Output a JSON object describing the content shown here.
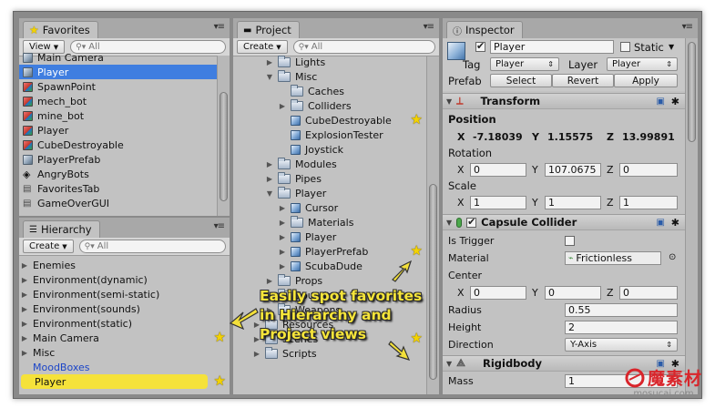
{
  "favorites": {
    "tab_label": "Favorites",
    "view_label": "View",
    "search_placeholder": "All",
    "items": [
      {
        "label": "Main Camera",
        "icon": "cube-gray"
      },
      {
        "label": "Player",
        "icon": "cube-gray",
        "selected": true
      },
      {
        "label": "SpawnPoint",
        "icon": "cube-red"
      },
      {
        "label": "mech_bot",
        "icon": "cube-red"
      },
      {
        "label": "mine_bot",
        "icon": "cube-red"
      },
      {
        "label": "Player",
        "icon": "cube-red"
      },
      {
        "label": "CubeDestroyable",
        "icon": "cube-red"
      },
      {
        "label": "PlayerPrefab",
        "icon": "cube-gray"
      },
      {
        "label": "AngryBots",
        "icon": "unity-icon"
      },
      {
        "label": "FavoritesTab",
        "icon": "script-icon"
      },
      {
        "label": "GameOverGUI",
        "icon": "script-icon"
      }
    ]
  },
  "hierarchy": {
    "tab_label": "Hierarchy",
    "create_label": "Create",
    "search_placeholder": "All",
    "items": [
      {
        "label": "Enemies",
        "arrow": true
      },
      {
        "label": "Environment(dynamic)",
        "arrow": true
      },
      {
        "label": "Environment(semi-static)",
        "arrow": true
      },
      {
        "label": "Environment(sounds)",
        "arrow": true
      },
      {
        "label": "Environment(static)",
        "arrow": true
      },
      {
        "label": "Main Camera",
        "arrow": true,
        "star": true
      },
      {
        "label": "Misc",
        "arrow": true
      },
      {
        "label": "MoodBoxes",
        "arrow": false,
        "blue": true
      },
      {
        "label": "Player",
        "arrow": false,
        "highlight": true,
        "star": true
      }
    ]
  },
  "project": {
    "tab_label": "Project",
    "create_label": "Create",
    "search_placeholder": "All",
    "items": [
      {
        "label": "Lights",
        "depth": 0,
        "arrow": "right",
        "icon": "folder"
      },
      {
        "label": "Misc",
        "depth": 0,
        "arrow": "down",
        "icon": "folder"
      },
      {
        "label": "Caches",
        "depth": 1,
        "arrow": "",
        "icon": "folder"
      },
      {
        "label": "Colliders",
        "depth": 1,
        "arrow": "right",
        "icon": "folder"
      },
      {
        "label": "CubeDestroyable",
        "depth": 1,
        "arrow": "",
        "icon": "cube",
        "star": true
      },
      {
        "label": "ExplosionTester",
        "depth": 1,
        "arrow": "",
        "icon": "cube"
      },
      {
        "label": "Joystick",
        "depth": 1,
        "arrow": "",
        "icon": "cube"
      },
      {
        "label": "Modules",
        "depth": 0,
        "arrow": "right",
        "icon": "folder"
      },
      {
        "label": "Pipes",
        "depth": 0,
        "arrow": "right",
        "icon": "folder"
      },
      {
        "label": "Player",
        "depth": 0,
        "arrow": "down",
        "icon": "folder"
      },
      {
        "label": "Cursor",
        "depth": 1,
        "arrow": "right",
        "icon": "cube"
      },
      {
        "label": "Materials",
        "depth": 1,
        "arrow": "right",
        "icon": "folder"
      },
      {
        "label": "Player",
        "depth": 1,
        "arrow": "right",
        "icon": "cube"
      },
      {
        "label": "PlayerPrefab",
        "depth": 1,
        "arrow": "right",
        "icon": "cube",
        "star": true
      },
      {
        "label": "ScubaDude",
        "depth": 1,
        "arrow": "right",
        "icon": "cube"
      },
      {
        "label": "Props",
        "depth": 0,
        "arrow": "right",
        "icon": "folder"
      },
      {
        "label": "Sounds",
        "depth": 0,
        "arrow": "right",
        "icon": "folder"
      },
      {
        "label": "Weapons",
        "depth": 0,
        "arrow": "right",
        "icon": "folder"
      },
      {
        "label": "Resources",
        "depth": -1,
        "arrow": "right",
        "icon": "folder"
      },
      {
        "label": "Scenes",
        "depth": -1,
        "arrow": "right",
        "icon": "folder",
        "star": true
      },
      {
        "label": "Scripts",
        "depth": -1,
        "arrow": "right",
        "icon": "folder"
      }
    ]
  },
  "inspector": {
    "tab_label": "Inspector",
    "object_name": "Player",
    "static_label": "Static",
    "tag_label": "Tag",
    "tag_value": "Player",
    "layer_label": "Layer",
    "layer_value": "Player",
    "prefab_label": "Prefab",
    "select_label": "Select",
    "revert_label": "Revert",
    "apply_label": "Apply",
    "transform": {
      "title": "Transform",
      "position_label": "Position",
      "position": {
        "x": "-7.18039",
        "y": "1.15575",
        "z": "13.99891"
      },
      "rotation_label": "Rotation",
      "rotation": {
        "x": "0",
        "y": "107.0675",
        "z": "0"
      },
      "scale_label": "Scale",
      "scale": {
        "x": "1",
        "y": "1",
        "z": "1"
      }
    },
    "capsule": {
      "title": "Capsule Collider",
      "is_trigger_label": "Is Trigger",
      "material_label": "Material",
      "material_value": "Frictionless",
      "center_label": "Center",
      "center": {
        "x": "0",
        "y": "0",
        "z": "0"
      },
      "radius_label": "Radius",
      "radius_value": "0.55",
      "height_label": "Height",
      "height_value": "2",
      "direction_label": "Direction",
      "direction_value": "Y-Axis"
    },
    "rigidbody": {
      "title": "Rigidbody",
      "mass_label": "Mass",
      "mass_value": "1"
    },
    "axis": {
      "x": "X",
      "y": "Y",
      "z": "Z"
    }
  },
  "annotation": {
    "line1": "Easily spot favorites",
    "line2": "in Hierarchy and",
    "line3": "Project views"
  },
  "watermark": {
    "brand": "魔素材",
    "url": "mosucai.com"
  },
  "colors": {
    "selection": "#3f7ee0",
    "highlight": "#f5e23a",
    "star": "#f3d200",
    "annotation_text": "#f6e53a",
    "watermark_red": "#d9252b"
  }
}
